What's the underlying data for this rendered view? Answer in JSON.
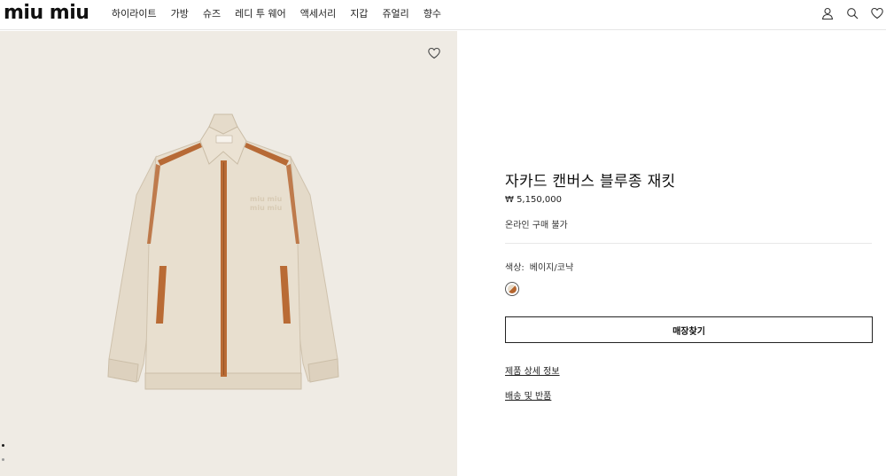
{
  "header": {
    "logo": "miu miu",
    "nav": [
      "하이라이트",
      "가방",
      "슈즈",
      "레디 투 웨어",
      "액세서리",
      "지갑",
      "쥬얼리",
      "향수"
    ],
    "icons": [
      "user-icon",
      "search-icon",
      "heart-icon"
    ]
  },
  "gallery": {
    "wishlist_icon": "heart-icon",
    "image": "jacket-image",
    "dots": 2,
    "active_dot": 0
  },
  "product": {
    "title": "자카드 캔버스 블루종 재킷",
    "price": "₩ 5,150,000",
    "availability": "온라인 구매 불가",
    "color_label": "색상:",
    "color_value": "베이지/코냑",
    "swatch_colors": [
      "#e7dccb",
      "#b5652e"
    ],
    "store_button": "매장찾기",
    "details_link": "제품 상세 정보",
    "shipping_link": "배송 및 반품"
  }
}
